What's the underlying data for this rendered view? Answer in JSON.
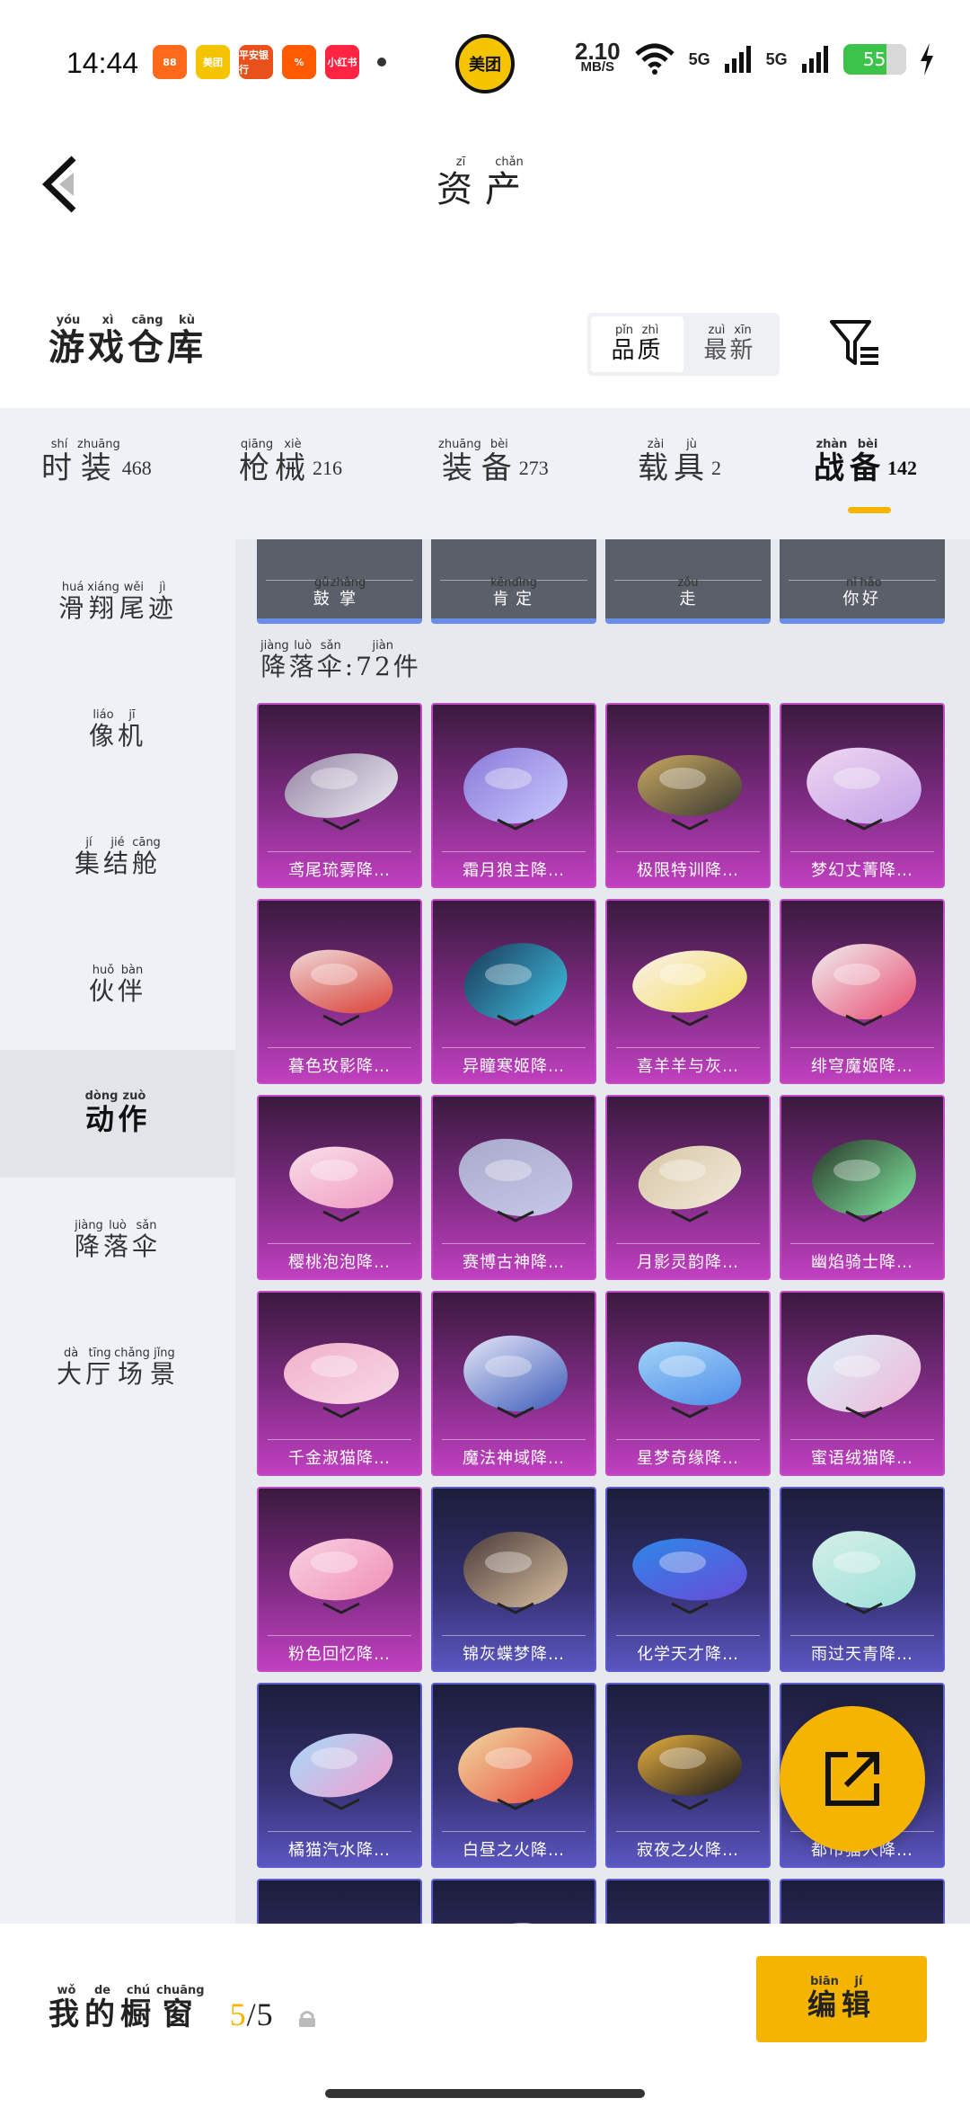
{
  "status_bar": {
    "time": "14:44",
    "apps": [
      {
        "label": "88",
        "color": "#ff6a1a"
      },
      {
        "label": "美团",
        "color": "#f5c400"
      },
      {
        "label": "平安银行",
        "color": "#e8501c"
      },
      {
        "label": "%",
        "color": "#ff5a00"
      },
      {
        "label": "小红书",
        "color": "#ff2442"
      }
    ],
    "center_app": "美团",
    "speed_value": "2.10",
    "speed_unit": "MB/S",
    "signal1": "5G",
    "signal2": "5G",
    "battery": "55"
  },
  "header": {
    "title": [
      {
        "char": "资",
        "py": "zī"
      },
      {
        "char": "产",
        "py": "chǎn"
      }
    ]
  },
  "warehouse": {
    "title": [
      {
        "char": "游",
        "py": "yóu"
      },
      {
        "char": "戏",
        "py": "xì"
      },
      {
        "char": "仓",
        "py": "cāng"
      },
      {
        "char": "库",
        "py": "kù"
      }
    ],
    "sort_quality": [
      {
        "char": "品",
        "py": "pǐn"
      },
      {
        "char": "质",
        "py": "zhì"
      }
    ],
    "sort_latest": [
      {
        "char": "最",
        "py": "zuì"
      },
      {
        "char": "新",
        "py": "xīn"
      }
    ]
  },
  "tabs": [
    {
      "name": [
        {
          "char": "时",
          "py": "shí"
        },
        {
          "char": "装",
          "py": "zhuāng"
        }
      ],
      "count": "468"
    },
    {
      "name": [
        {
          "char": "枪",
          "py": "qiāng"
        },
        {
          "char": "械",
          "py": "xiè"
        }
      ],
      "count": "216"
    },
    {
      "name": [
        {
          "char": "装",
          "py": "zhuāng"
        },
        {
          "char": "备",
          "py": "bèi"
        }
      ],
      "count": "273"
    },
    {
      "name": [
        {
          "char": "载",
          "py": "zài"
        },
        {
          "char": "具",
          "py": "jù"
        }
      ],
      "count": "2"
    },
    {
      "name": [
        {
          "char": "战",
          "py": "zhàn"
        },
        {
          "char": "备",
          "py": "bèi"
        }
      ],
      "count": "142"
    }
  ],
  "sidebar": [
    [
      {
        "char": "滑",
        "py": "huá"
      },
      {
        "char": "翔",
        "py": "xiáng"
      },
      {
        "char": "尾",
        "py": "wěi"
      },
      {
        "char": "迹",
        "py": "jì"
      }
    ],
    [
      {
        "char": "像",
        "py": "liáo"
      },
      {
        "char": "机",
        "py": "jī"
      }
    ],
    [
      {
        "char": "集",
        "py": "jí"
      },
      {
        "char": "结",
        "py": "jié"
      },
      {
        "char": "舱",
        "py": "cāng"
      }
    ],
    [
      {
        "char": "伙",
        "py": "huǒ"
      },
      {
        "char": "伴",
        "py": "bàn"
      }
    ],
    [
      {
        "char": "动",
        "py": "dòng"
      },
      {
        "char": "作",
        "py": "zuò"
      }
    ],
    [
      {
        "char": "降",
        "py": "jiàng"
      },
      {
        "char": "落",
        "py": "luò"
      },
      {
        "char": "伞",
        "py": "sǎn"
      }
    ],
    [
      {
        "char": "大",
        "py": "dà"
      },
      {
        "char": "厅",
        "py": "tīng"
      },
      {
        "char": "场",
        "py": "chǎng"
      },
      {
        "char": "景",
        "py": "jǐng"
      }
    ]
  ],
  "prev_row": [
    [
      {
        "char": "鼓",
        "py": "gǔ"
      },
      {
        "char": "掌",
        "py": "zhǎng"
      }
    ],
    [
      {
        "char": "肯",
        "py": "kěn"
      },
      {
        "char": "定",
        "py": "dìng"
      }
    ],
    [
      {
        "char": "走",
        "py": "zǒu"
      }
    ],
    [
      {
        "char": "你",
        "py": "nǐ"
      },
      {
        "char": "好",
        "py": "hǎo"
      }
    ]
  ],
  "section": {
    "label": [
      {
        "char": "降",
        "py": "jiàng"
      },
      {
        "char": "落",
        "py": "luò"
      },
      {
        "char": "伞",
        "py": "sǎn"
      }
    ],
    "count_text": ":72件",
    "jian_py": "jiàn"
  },
  "items": [
    {
      "name": "鸢尾琉雾降…",
      "color": "purple",
      "c1": "#e8e8f0",
      "c2": "#9a8aa8"
    },
    {
      "name": "霜月狼主降…",
      "color": "purple",
      "c1": "#c8c8ff",
      "c2": "#8a7ad8"
    },
    {
      "name": "极限特训降…",
      "color": "purple",
      "c1": "#3a3a32",
      "c2": "#c8a860"
    },
    {
      "name": "梦幻丈菁降…",
      "color": "purple",
      "c1": "#c0a0e8",
      "c2": "#f0d8f0"
    },
    {
      "name": "暮色玫影降…",
      "color": "purple",
      "c1": "#d83a30",
      "c2": "#f0e0e0"
    },
    {
      "name": "异瞳寒姬降…",
      "color": "purple",
      "c1": "#40c0e0",
      "c2": "#1a3a5a"
    },
    {
      "name": "喜羊羊与灰…",
      "color": "purple",
      "c1": "#f5e060",
      "c2": "#f8f0e8"
    },
    {
      "name": "绯穹魔姬降…",
      "color": "purple",
      "c1": "#e84a70",
      "c2": "#f0f0f0"
    },
    {
      "name": "樱桃泡泡降…",
      "color": "purple",
      "c1": "#f09ac0",
      "c2": "#f8e0ea"
    },
    {
      "name": "赛博古神降…",
      "color": "purple",
      "c1": "#c8c8e8",
      "c2": "#a8a8c8"
    },
    {
      "name": "月影灵韵降…",
      "color": "purple",
      "c1": "#f0e8d8",
      "c2": "#d8c8a8"
    },
    {
      "name": "幽焰骑士降…",
      "color": "purple",
      "c1": "#80e8a0",
      "c2": "#2a3a2a"
    },
    {
      "name": "千金淑猫降…",
      "color": "purple",
      "c1": "#f8d8e8",
      "c2": "#f0b0c8"
    },
    {
      "name": "魔法神域降…",
      "color": "purple",
      "c1": "#3a5ab8",
      "c2": "#e8e8f8"
    },
    {
      "name": "星梦奇缘降…",
      "color": "purple",
      "c1": "#4a8ae8",
      "c2": "#a8d8f8"
    },
    {
      "name": "蜜语绒猫降…",
      "color": "purple",
      "c1": "#f0b8d8",
      "c2": "#d8f0f8"
    },
    {
      "name": "粉色回忆降…",
      "color": "purple",
      "c1": "#f090b8",
      "c2": "#f8d0e0"
    },
    {
      "name": "锦灰蝶梦降…",
      "color": "indigo",
      "c1": "#d8c0a0",
      "c2": "#4a3a3a"
    },
    {
      "name": "化学天才降…",
      "color": "indigo",
      "c1": "#6a4ad8",
      "c2": "#2a8ae8"
    },
    {
      "name": "雨过天青降…",
      "color": "indigo",
      "c1": "#9ae0d8",
      "c2": "#d8f0e8"
    },
    {
      "name": "橘猫汽水降…",
      "color": "indigo",
      "c1": "#f0a0d0",
      "c2": "#a8d8f8"
    },
    {
      "name": "白昼之火降…",
      "color": "indigo",
      "c1": "#e84a3a",
      "c2": "#f0d8a0"
    },
    {
      "name": "寂夜之火降…",
      "color": "indigo",
      "c1": "#1a1a1a",
      "c2": "#e8b040"
    },
    {
      "name": "都市猫人降…",
      "color": "indigo",
      "c1": "#c8c8d8",
      "c2": "#3a3a5a"
    },
    {
      "name": "",
      "color": "indigo",
      "c1": "#c85a8a",
      "c2": "#d8d8e8"
    },
    {
      "name": "",
      "color": "indigo",
      "c1": "#d8d8e8",
      "c2": "#9898b8"
    },
    {
      "name": "",
      "color": "indigo",
      "c1": "#e84a5a",
      "c2": "#f0c0c0"
    },
    {
      "name": "",
      "color": "indigo",
      "c1": "#80d8b0",
      "c2": "#d8f0e8"
    }
  ],
  "bottom": {
    "showcase": [
      {
        "char": "我",
        "py": "wǒ"
      },
      {
        "char": "的",
        "py": "de"
      },
      {
        "char": "橱",
        "py": "chú"
      },
      {
        "char": "窗",
        "py": "chuāng"
      }
    ],
    "current": "5",
    "total": "/5",
    "edit": [
      {
        "char": "编",
        "py": "biān"
      },
      {
        "char": "辑",
        "py": "jí"
      }
    ]
  }
}
